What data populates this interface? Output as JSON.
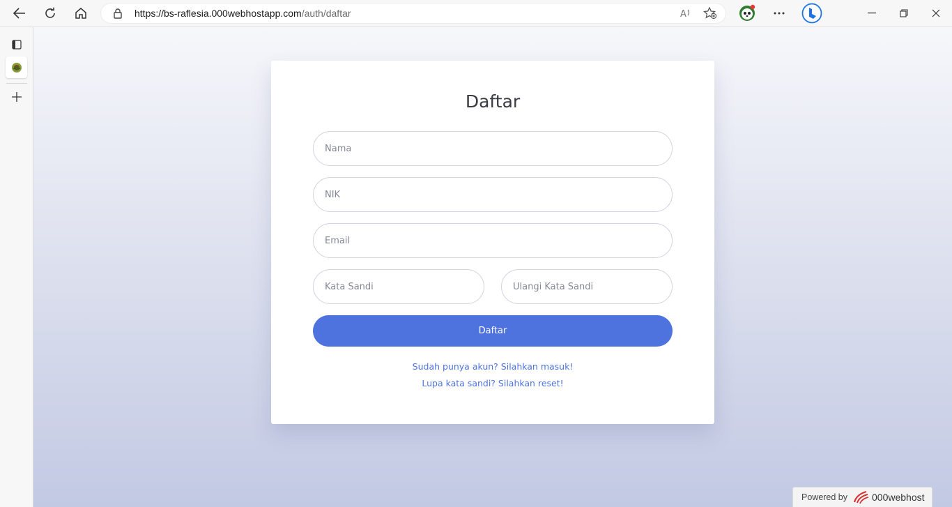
{
  "browser": {
    "url_host": "https://bs-raflesia.000webhostapp.com",
    "url_path": "/auth/daftar"
  },
  "form": {
    "title": "Daftar",
    "fields": {
      "nama": "Nama",
      "nik": "NIK",
      "email": "Email",
      "password": "Kata Sandi",
      "repeat_password": "Ulangi Kata Sandi"
    },
    "submit_label": "Daftar",
    "login_link": "Sudah punya akun? Silahkan masuk!",
    "reset_link": "Lupa kata sandi? Silahkan reset!"
  },
  "footer": {
    "powered_by": "Powered by",
    "brand": "000webhost"
  },
  "colors": {
    "primary": "#4e73df",
    "link": "#4e73df",
    "brand_red": "#d83131"
  },
  "icons": [
    "back-icon",
    "refresh-icon",
    "home-icon",
    "lock-icon",
    "read-aloud-icon",
    "favorite-add-icon",
    "profile-avatar-icon",
    "more-icon",
    "bing-icon",
    "minimize-icon",
    "restore-icon",
    "close-icon",
    "tab-actions-icon",
    "site-tab-icon",
    "new-tab-icon",
    "webhost-logo-icon"
  ]
}
